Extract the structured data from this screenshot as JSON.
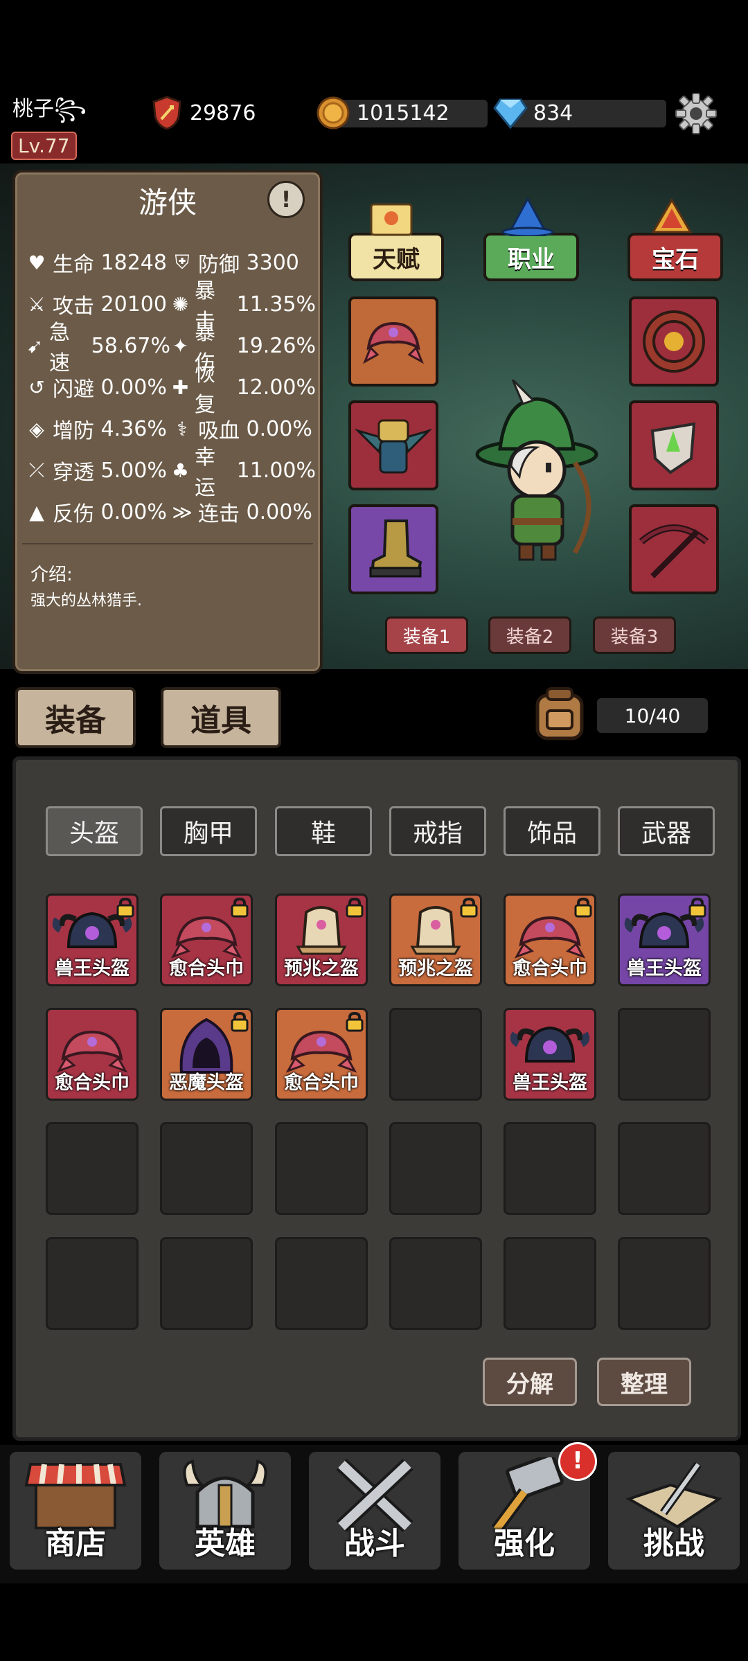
{
  "header": {
    "player_name": "桃子꧂",
    "level": "Lv.77",
    "power": "29876",
    "gold": "1015142",
    "gems": "834"
  },
  "hero": {
    "class_title": "游侠",
    "stats": [
      [
        {
          "label": "生命",
          "value": "18248"
        },
        {
          "label": "防御",
          "value": "3300"
        }
      ],
      [
        {
          "label": "攻击",
          "value": "20100"
        },
        {
          "label": "暴击",
          "value": "11.35%"
        }
      ],
      [
        {
          "label": "急速",
          "value": "58.67%"
        },
        {
          "label": "暴伤",
          "value": "19.26%"
        }
      ],
      [
        {
          "label": "闪避",
          "value": "0.00%"
        },
        {
          "label": "恢复",
          "value": "12.00%"
        }
      ],
      [
        {
          "label": "增防",
          "value": "4.36%"
        },
        {
          "label": "吸血",
          "value": "0.00%"
        }
      ],
      [
        {
          "label": "穿透",
          "value": "5.00%"
        },
        {
          "label": "幸运",
          "value": "11.00%"
        }
      ],
      [
        {
          "label": "反伤",
          "value": "0.00%"
        },
        {
          "label": "连击",
          "value": "0.00%"
        }
      ]
    ],
    "intro_label": "介绍:",
    "intro_text": "强大的丛林猎手."
  },
  "right_panel": {
    "talent": "天赋",
    "job": "职业",
    "gem": "宝石",
    "equip_sets": [
      "装备1",
      "装备2",
      "装备3"
    ]
  },
  "tabs": {
    "equipment": "装备",
    "items": "道具",
    "capacity": "10/40"
  },
  "categories": [
    "头盔",
    "胸甲",
    "鞋",
    "戒指",
    "饰品",
    "武器"
  ],
  "inventory": [
    {
      "name": "兽王头盔",
      "rarity": "red",
      "locked": true,
      "icon": "beast-helmet-icon"
    },
    {
      "name": "愈合头巾",
      "rarity": "red",
      "locked": true,
      "icon": "healing-bandana-icon"
    },
    {
      "name": "预兆之盔",
      "rarity": "red",
      "locked": true,
      "icon": "omen-helm-icon"
    },
    {
      "name": "预兆之盔",
      "rarity": "orange",
      "locked": true,
      "icon": "omen-helm-icon"
    },
    {
      "name": "愈合头巾",
      "rarity": "orange",
      "locked": true,
      "icon": "healing-bandana-icon"
    },
    {
      "name": "兽王头盔",
      "rarity": "purple",
      "locked": true,
      "icon": "beast-helmet-icon"
    },
    {
      "name": "愈合头巾",
      "rarity": "red",
      "locked": false,
      "icon": "healing-bandana-icon"
    },
    {
      "name": "恶魔头盔",
      "rarity": "orange",
      "locked": true,
      "icon": "demon-hood-icon"
    },
    {
      "name": "愈合头巾",
      "rarity": "orange",
      "locked": true,
      "icon": "healing-bandana-icon"
    },
    {
      "name": "",
      "rarity": "empty",
      "locked": false,
      "icon": ""
    },
    {
      "name": "兽王头盔",
      "rarity": "red",
      "locked": false,
      "icon": "beast-helmet-icon"
    }
  ],
  "actions": {
    "decompose": "分解",
    "organize": "整理"
  },
  "nav": {
    "shop": "商店",
    "hero": "英雄",
    "battle": "战斗",
    "enhance": "强化",
    "challenge": "挑战",
    "enhance_badge": "!"
  }
}
